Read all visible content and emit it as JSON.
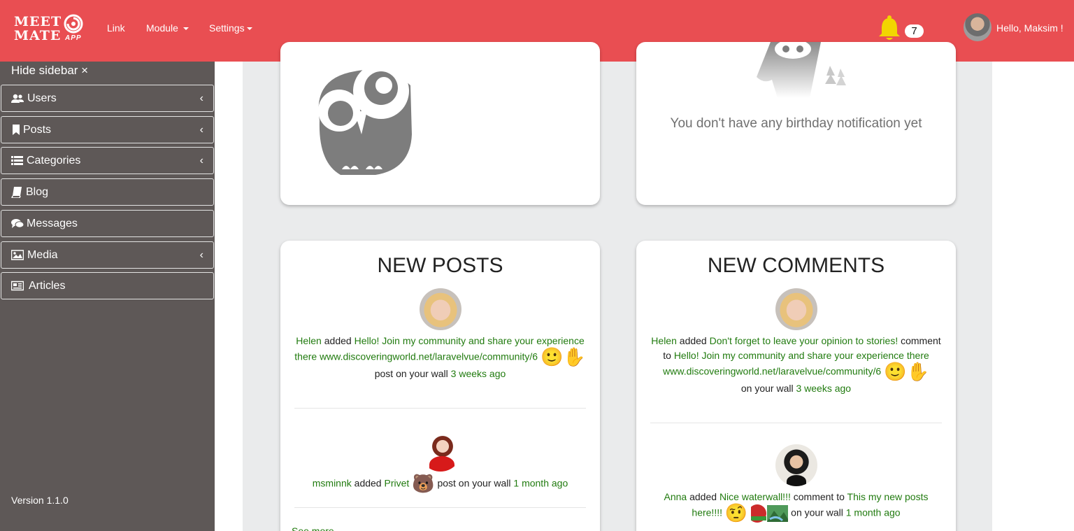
{
  "nav": {
    "logo_line1": "MEET",
    "logo_line2": "MATE",
    "logo_app": "APP",
    "link": "Link",
    "module": "Module",
    "settings": "Settings",
    "notification_count": "7",
    "greeting": "Hello, Maksim !"
  },
  "sidebar": {
    "hide": "Hide sidebar ×",
    "items": [
      {
        "label": "Users",
        "icon": "users-icon"
      },
      {
        "label": "Posts",
        "icon": "bookmark-icon"
      },
      {
        "label": "Categories",
        "icon": "list-icon"
      },
      {
        "label": "Blog",
        "icon": "book-icon"
      },
      {
        "label": "Messages",
        "icon": "comments-icon"
      },
      {
        "label": "Media",
        "icon": "image-icon"
      },
      {
        "label": "Articles",
        "icon": "newspaper-icon"
      }
    ],
    "version": "Version 1.1.0"
  },
  "birthday": {
    "empty": "You don't have any birthday notification yet"
  },
  "new_posts": {
    "title": "NEW POSTS",
    "items": [
      {
        "user": "Helen",
        "verb": "added",
        "link_text": "Hello! Join my community and share your experience there www.discoveringworld.net/laravelvue/community/6",
        "suffix": "post on your wall",
        "time": "3 weeks ago"
      },
      {
        "user": "msminnk",
        "verb": "added",
        "link_text": "Privet",
        "suffix": "post on your wall",
        "time": "1 month ago"
      }
    ],
    "see_more": "See more"
  },
  "new_comments": {
    "title": "NEW COMMENTS",
    "items": [
      {
        "user": "Helen",
        "verb": "added",
        "link_text": "Don't forget to leave your opinion to stories!",
        "mid": "comment to",
        "target": "Hello! Join my community and share your experience there www.discoveringworld.net/laravelvue/community/6",
        "suffix": "on your wall",
        "time": "3 weeks ago"
      },
      {
        "user": "Anna",
        "verb": "added",
        "link_text": "Nice waterwall!!!",
        "mid": "comment to",
        "target": "This my new posts here!!!!",
        "suffix": "on your wall",
        "time": "1 month ago"
      }
    ]
  }
}
